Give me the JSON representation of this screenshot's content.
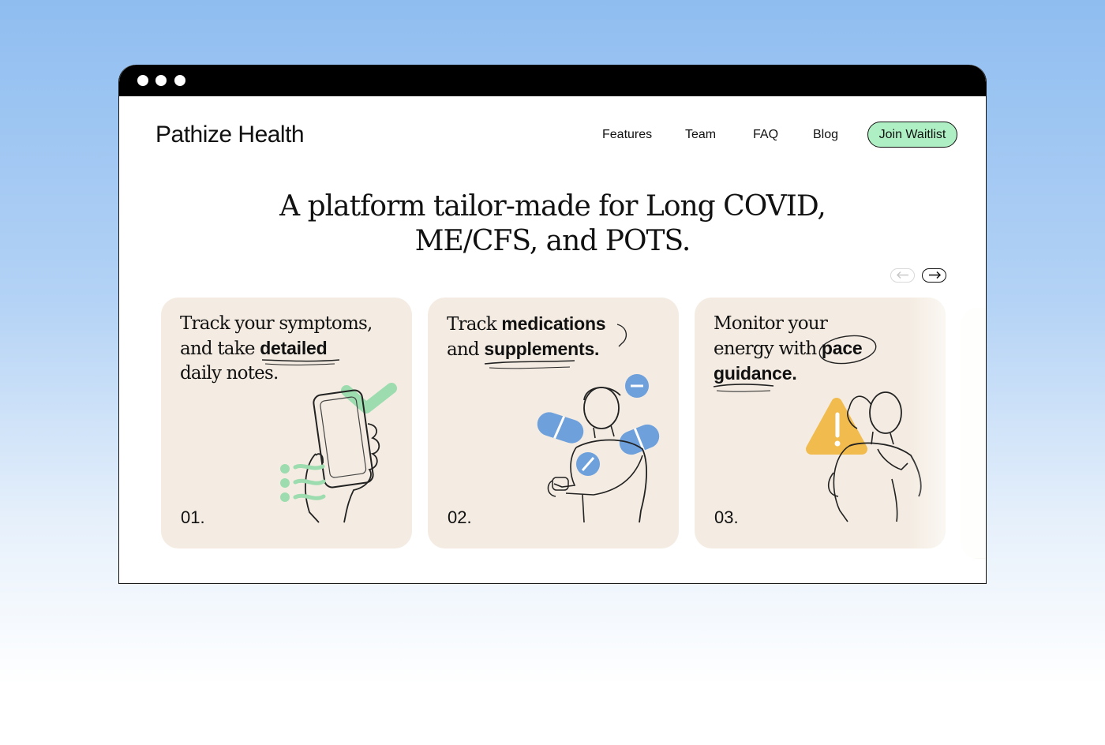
{
  "brand": "Pathize Health",
  "nav": {
    "links": [
      "Features",
      "Team",
      "FAQ",
      "Blog"
    ],
    "cta": "Join Waitlist"
  },
  "hero": {
    "line1": "A platform tailor-made for Long COVID,",
    "line2": "ME/CFS, and POTS."
  },
  "carousel": {
    "prev_icon": "arrow-left-icon",
    "next_icon": "arrow-right-icon",
    "cards": [
      {
        "t1": "Track your symptoms,",
        "t2": "and take ",
        "t2b": "detailed",
        "t3": "daily notes.",
        "number": "01.",
        "icon": "phone-check-illustration"
      },
      {
        "t1": "Track ",
        "t1b": "medications",
        "t2": "and ",
        "t2b": "supplements.",
        "number": "02.",
        "icon": "pills-person-illustration"
      },
      {
        "t1": "Monitor your",
        "t2": "energy with ",
        "t2b": "pace",
        "t3b": "guidance.",
        "number": "03.",
        "icon": "warning-woman-illustration"
      }
    ]
  },
  "colors": {
    "background_top": "#8fbdf0",
    "card_bg": "#f4ece2",
    "cta_green": "#aef0c4",
    "pill_blue": "#6ea0dc",
    "warning_yellow": "#f2bb4d",
    "check_green": "#9ddcae"
  }
}
